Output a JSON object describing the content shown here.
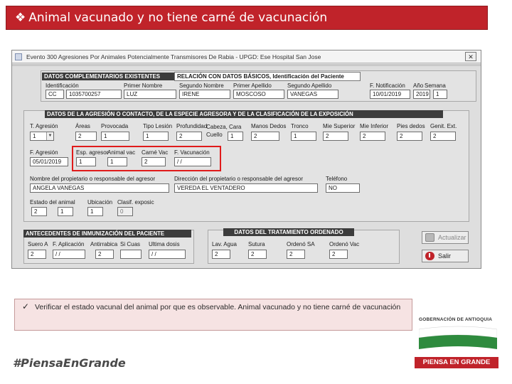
{
  "slide": {
    "title": "Animal vacunado y no tiene carné de vacunación",
    "note": "Verificar el estado vacunal del animal por que es observable. Animal vacunado y no tiene carné de vacunación",
    "hashtag": "#PiensaEnGrande",
    "logo": {
      "gov": "GOBERNACIÓN DE ANTIOQUIA",
      "brand": "PIENSA EN GRANDE"
    }
  },
  "window": {
    "title": "Evento 300  Agresiones Por Animales Potencialmente Transmisores De Rabia - UPGD: Ese Hospital San Jose",
    "close": "✕"
  },
  "complementarios": {
    "header": "DATOS COMPLEMENTARIOS EXISTENTES",
    "relacion": "RELACIÓN CON DATOS BÁSICOS,  Identificación del Paciente",
    "labels": {
      "identificacion": "Identificación",
      "primer_nombre": "Primer Nombre",
      "segundo_nombre": "Segundo Nombre",
      "primer_apellido": "Primer Apellido",
      "segundo_apellido": "Segundo Apellido",
      "f_notificacion": "F. Notificación",
      "ano": "Año",
      "semana": "Semana"
    },
    "values": {
      "tipo_id": "CC",
      "numero_id": "1035700257",
      "primer_nombre": "LUZ",
      "segundo_nombre": "IRENE",
      "primer_apellido": "MOSCOSO",
      "segundo_apellido": "VANEGAS",
      "f_notificacion": "10/01/2019",
      "ano": "2019",
      "semana": "1"
    }
  },
  "agresion": {
    "header": "DATOS DE LA AGRESIÓN O CONTACTO, DE LA ESPECIE AGRESORA Y DE LA CLASIFICACIÓN DE LA EXPOSICIÓN",
    "labels": {
      "tipo": "T. Agresión",
      "areas": "Áreas",
      "provocada": "Provocada",
      "tipo_lesion": "Tipo Lesión",
      "profundidad": "Profundidad",
      "cabeza": "Cabeza, Cara\nCuello",
      "manos": "Manos Dedos",
      "tronco": "Tronco",
      "mie_sup": "Mie Superior",
      "mie_inf": "Mie Inferior",
      "pies": "Pies dedos",
      "genit": "Genit. Ext.",
      "f_agresion": "F. Agresión",
      "esp_agresor": "Esp. agresor",
      "animal_vac": "Animal vac",
      "carne_vac": "Carné Vac",
      "f_vacunacion": "F. Vacunación",
      "propietario": "Nombre del propietario o responsable del agresor",
      "direccion": "Dirección del propietario o responsable del agresor",
      "telefono": "Teléfono",
      "estado_animal": "Estado del animal",
      "ubicacion": "Ubicación",
      "clasif": "Clasif. exposic"
    },
    "values": {
      "tipo": "1",
      "areas": "2",
      "provocada": "1",
      "tipo_lesion": "1",
      "profundidad": "2",
      "cabeza": "1",
      "manos": "2",
      "tronco": "1",
      "mie_sup": "2",
      "mie_inf": "2",
      "pies": "2",
      "genit": "2",
      "f_agresion": "05/01/2019",
      "esp_agresor": "1",
      "animal_vac": "1",
      "carne_vac": "2",
      "f_vacunacion": "/ /",
      "propietario": "ANGELA VANEGAS",
      "direccion": "VEREDA EL VENTADERO",
      "telefono": "NO",
      "estado_animal": "2",
      "ubicacion": "1",
      "clasif": "1",
      "clasif_extra": "0"
    }
  },
  "inmunizacion": {
    "header": "ANTECEDENTES DE INMUNIZACIÓN DEL PACIENTE",
    "labels": {
      "suero": "Suero A",
      "f_aplicacion": "F. Aplicación",
      "antirrabica": "Antirrabica",
      "si_cuas": "Si Cuas",
      "ultima_dosis": "Ultima dosis"
    },
    "values": {
      "suero": "2",
      "f_aplicacion": "/ /",
      "antirrabica": "2",
      "si_cuas": "",
      "ultima_dosis": "/ /"
    }
  },
  "tratamiento": {
    "header": "DATOS DEL TRATAMIENTO ORDENADO",
    "labels": {
      "lav_agua": "Lav. Agua",
      "sutura": "Sutura",
      "ord_suero": "Ordenó SA",
      "ord_vac": "Ordenó Vac"
    },
    "values": {
      "lav_agua": "2",
      "sutura": "2",
      "ord_suero": "2",
      "ord_vac": "2"
    }
  },
  "buttons": {
    "actualizar": "Actualizar",
    "salir": "Salir"
  }
}
